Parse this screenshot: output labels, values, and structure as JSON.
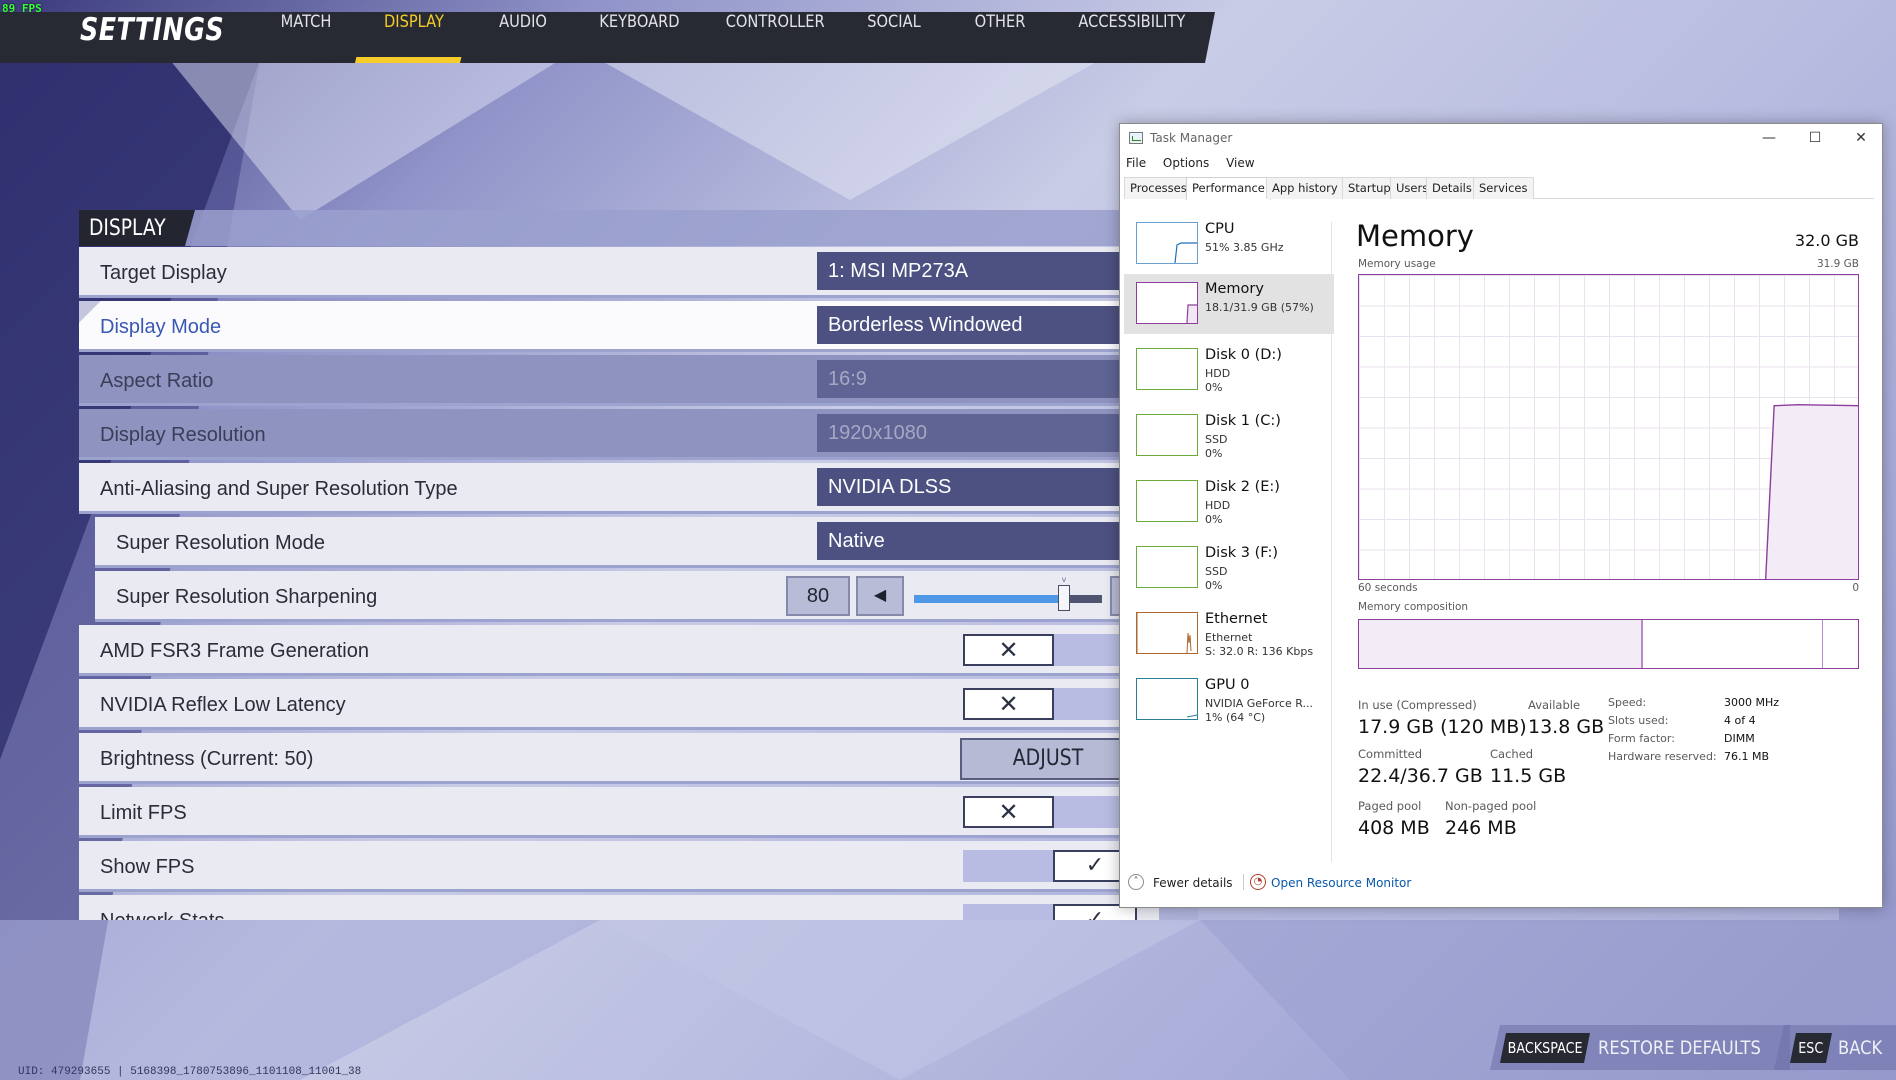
{
  "fps": "89 FPS",
  "nav": {
    "title": "SETTINGS",
    "tabs": [
      {
        "label": "MATCH"
      },
      {
        "label": "DISPLAY",
        "active": true
      },
      {
        "label": "AUDIO"
      },
      {
        "label": "KEYBOARD"
      },
      {
        "label": "CONTROLLER"
      },
      {
        "label": "SOCIAL"
      },
      {
        "label": "OTHER"
      },
      {
        "label": "ACCESSIBILITY"
      }
    ]
  },
  "display": {
    "section_title": "DISPLAY",
    "target_display": {
      "label": "Target Display",
      "value": "1: MSI MP273A"
    },
    "display_mode": {
      "label": "Display Mode",
      "value": "Borderless Windowed"
    },
    "aspect_ratio": {
      "label": "Aspect Ratio",
      "value": "16:9"
    },
    "resolution": {
      "label": "Display Resolution",
      "value": "1920x1080"
    },
    "aa_type": {
      "label": "Anti-Aliasing and Super Resolution Type",
      "value": "NVIDIA DLSS"
    },
    "sr_mode": {
      "label": "Super Resolution Mode",
      "value": "Native"
    },
    "sr_sharpening": {
      "label": "Super Resolution Sharpening",
      "value": "80",
      "fraction": 0.8
    },
    "fsr3": {
      "label": "AMD FSR3 Frame Generation",
      "checked": false
    },
    "reflex": {
      "label": "NVIDIA Reflex Low Latency",
      "checked": false
    },
    "brightness": {
      "label": "Brightness (Current: 50)",
      "button": "ADJUST"
    },
    "limit_fps": {
      "label": "Limit FPS",
      "checked": false
    },
    "show_fps": {
      "label": "Show FPS",
      "checked": true
    },
    "network_stats": {
      "label": "Network Stats",
      "checked": true
    }
  },
  "glyphs": {
    "x": "✕",
    "check": "✓",
    "left": "◀",
    "right": "▶",
    "tick": "˅"
  },
  "bottom": {
    "uid": "UID: 479293655 | 5168398_1780753896_1101108_11001_38",
    "backspace_key": "BACKSPACE",
    "restore_label": "RESTORE DEFAULTS",
    "esc_key": "ESC",
    "back_label": "BACK"
  },
  "task_manager": {
    "title": "Task Manager",
    "window_buttons": {
      "minimize": "—",
      "maximize": "☐",
      "close": "✕"
    },
    "menu": [
      "File",
      "Options",
      "View"
    ],
    "tabs": [
      "Processes",
      "Performance",
      "App history",
      "Startup",
      "Users",
      "Details",
      "Services"
    ],
    "active_tab": "Performance",
    "devices": [
      {
        "name": "CPU",
        "s1": "51% 3.85 GHz",
        "s2": ""
      },
      {
        "name": "Memory",
        "s1": "18.1/31.9 GB (57%)",
        "s2": ""
      },
      {
        "name": "Disk 0 (D:)",
        "s1": "HDD",
        "s2": "0%"
      },
      {
        "name": "Disk 1 (C:)",
        "s1": "SSD",
        "s2": "0%"
      },
      {
        "name": "Disk 2 (E:)",
        "s1": "HDD",
        "s2": "0%"
      },
      {
        "name": "Disk 3 (F:)",
        "s1": "SSD",
        "s2": "0%"
      },
      {
        "name": "Ethernet",
        "s1": "Ethernet",
        "s2": "S: 32.0 R: 136 Kbps"
      },
      {
        "name": "GPU 0",
        "s1": "NVIDIA GeForce R...",
        "s2": "1% (64 °C)"
      }
    ],
    "memory": {
      "title": "Memory",
      "total": "32.0 GB",
      "usage_label": "Memory usage",
      "usage_max": "31.9 GB",
      "axis_left": "60 seconds",
      "axis_right": "0",
      "composition_label": "Memory composition",
      "usage_fraction": 0.57,
      "in_use_label": "In use (Compressed)",
      "in_use": "17.9 GB (120 MB)",
      "available_label": "Available",
      "available": "13.8 GB",
      "committed_label": "Committed",
      "committed": "22.4/36.7 GB",
      "cached_label": "Cached",
      "cached": "11.5 GB",
      "paged_label": "Paged pool",
      "paged": "408 MB",
      "nonpaged_label": "Non-paged pool",
      "nonpaged": "246 MB",
      "speed_label": "Speed:",
      "speed": "3000 MHz",
      "slots_label": "Slots used:",
      "slots": "4 of 4",
      "form_label": "Form factor:",
      "form": "DIMM",
      "reserved_label": "Hardware reserved:",
      "reserved": "76.1 MB"
    },
    "footer": {
      "fewer": "Fewer details",
      "monitor": "Open Resource Monitor"
    }
  }
}
